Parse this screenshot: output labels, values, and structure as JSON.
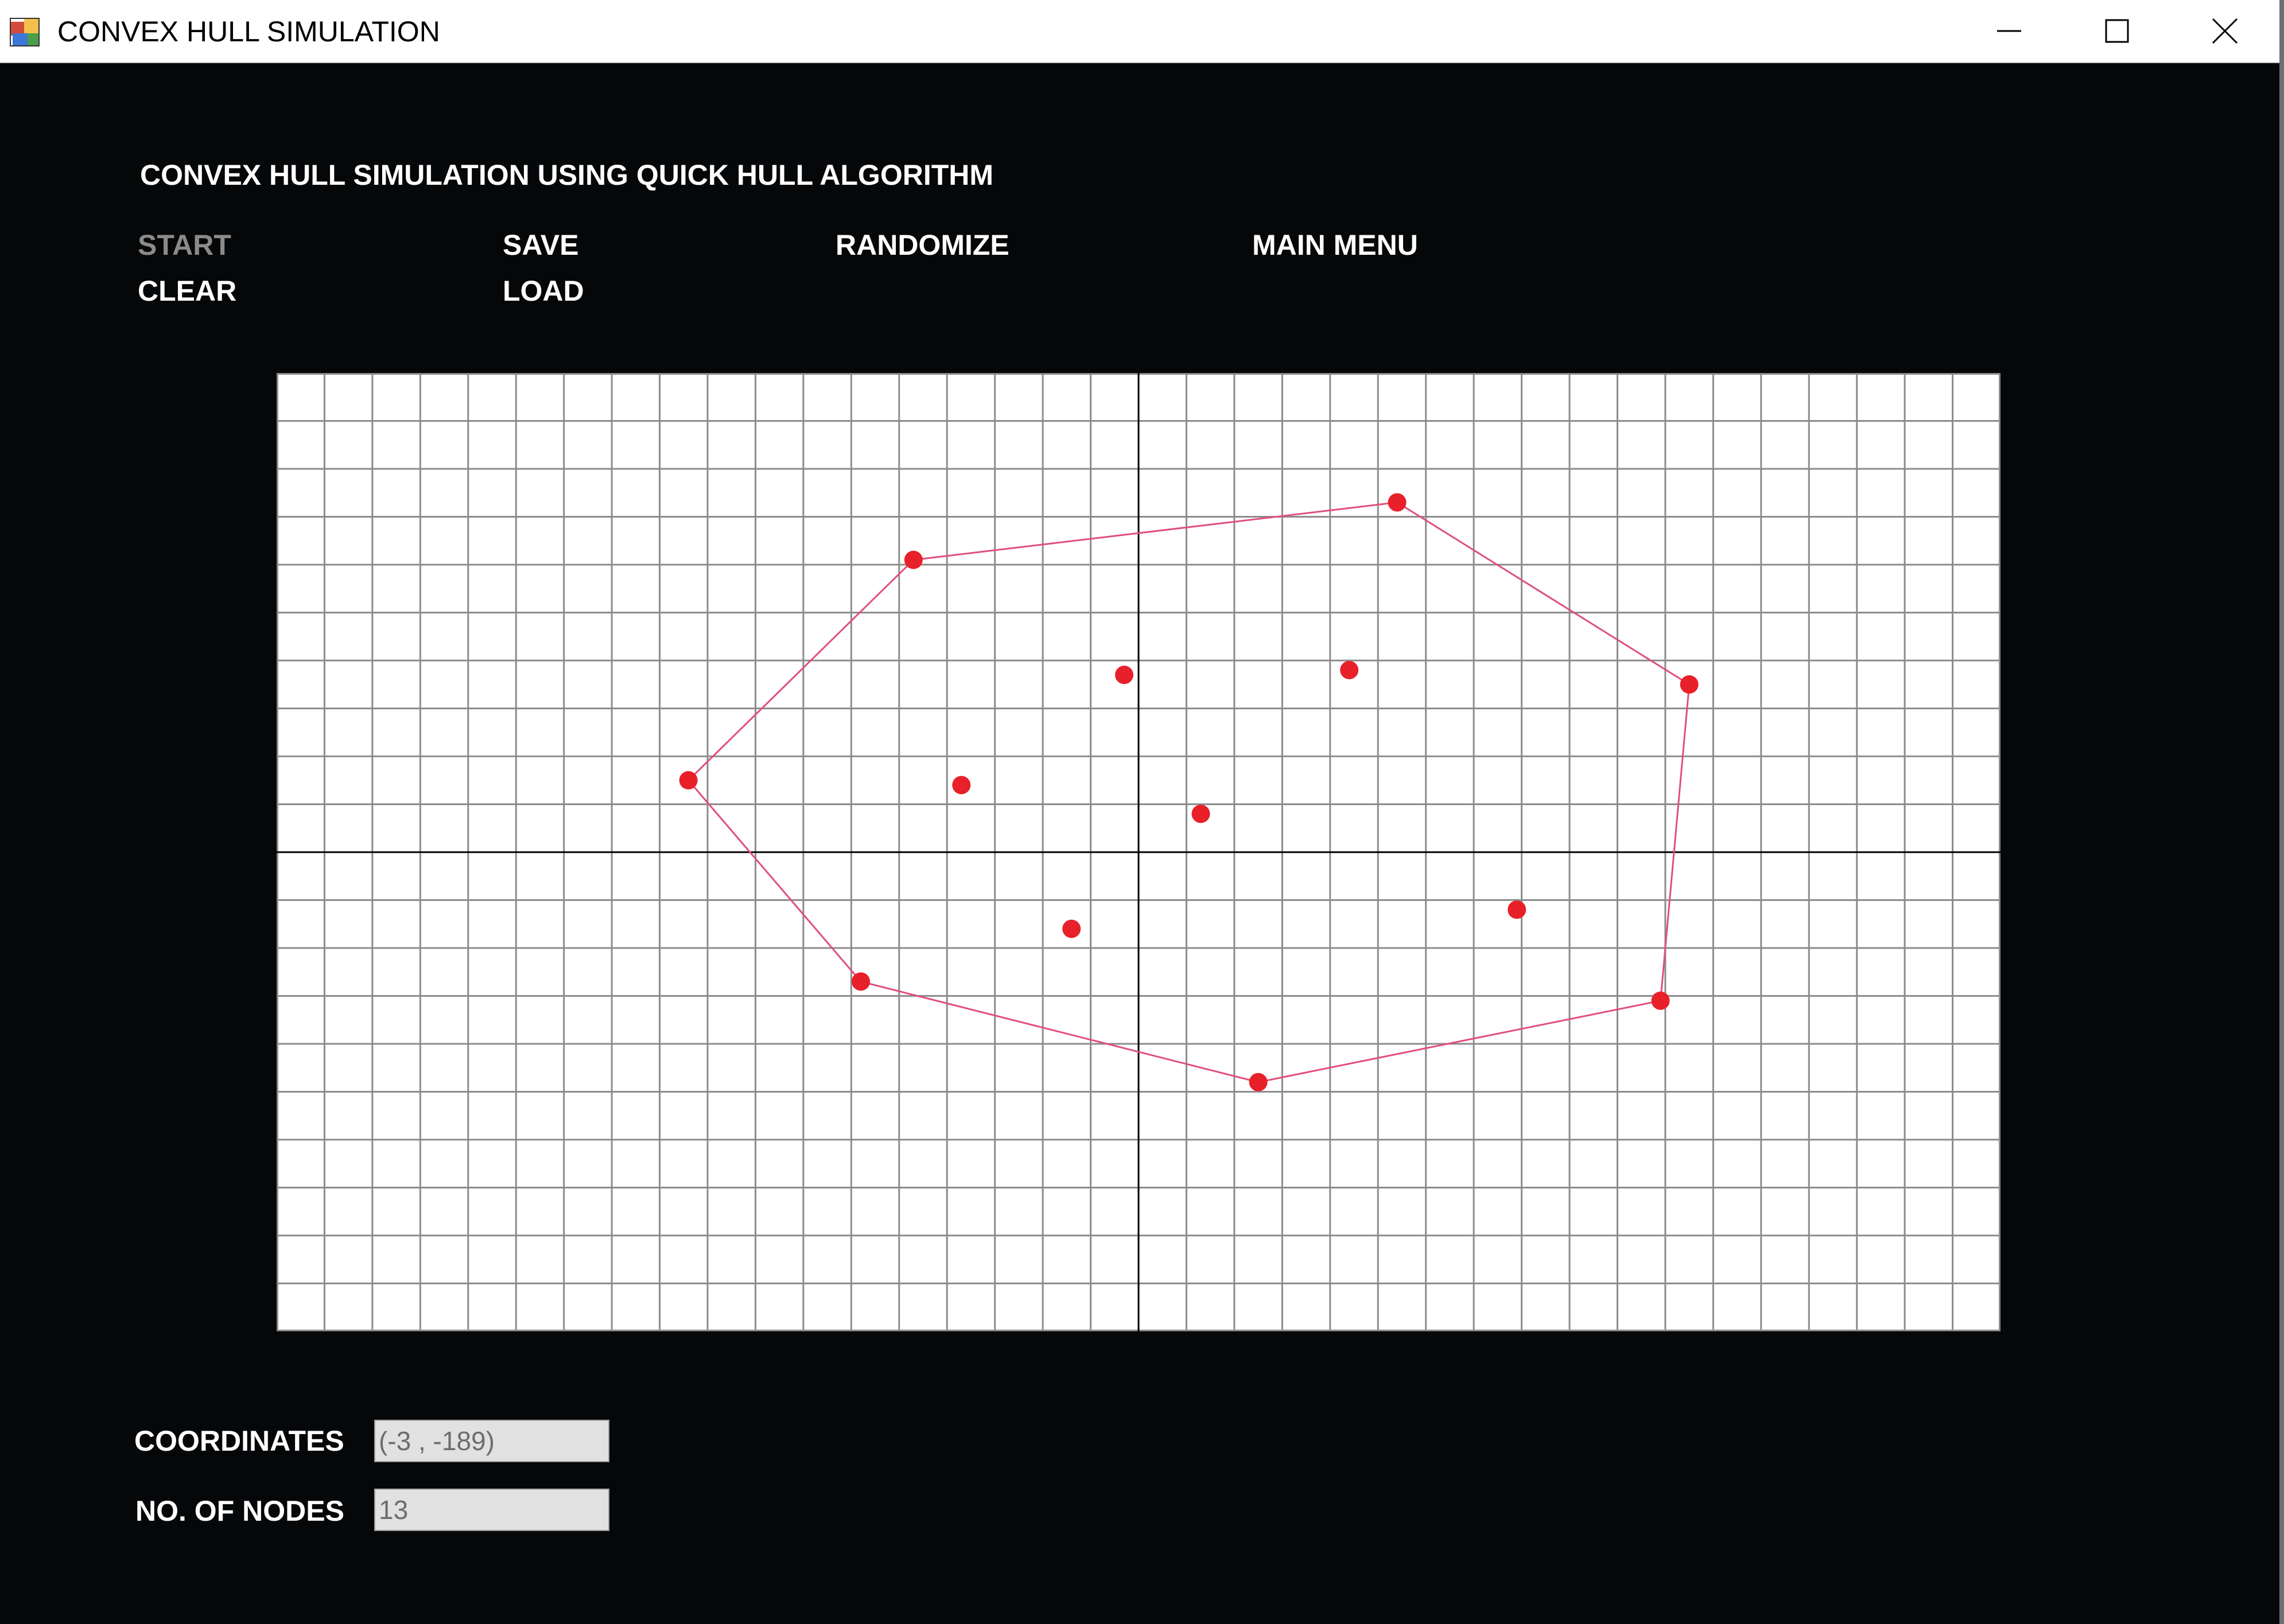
{
  "window": {
    "title": "CONVEX HULL SIMULATION",
    "icons": {
      "app": "app-icon",
      "minimize": "minimize-icon",
      "maximize": "maximize-icon",
      "close": "close-icon"
    }
  },
  "header": {
    "heading": "CONVEX HULL SIMULATION USING QUICK HULL ALGORITHM"
  },
  "menu": {
    "start": "START",
    "save": "SAVE",
    "randomize": "RANDOMIZE",
    "main_menu": "MAIN MENU",
    "clear": "CLEAR",
    "load": "LOAD"
  },
  "colors": {
    "background": "#050709",
    "grid_line": "#8c8c8c",
    "axis": "#000000",
    "node": "#e8202a",
    "hull": "#e0507a",
    "disabled_text": "#8a8a8a"
  },
  "chart_data": {
    "type": "scatter",
    "grid": true,
    "xlim": [
      -18,
      18
    ],
    "ylim": [
      -10,
      10
    ],
    "grid_step": 1,
    "points": [
      {
        "x": -4.7,
        "y": 6.1
      },
      {
        "x": 5.4,
        "y": 7.3
      },
      {
        "x": 11.5,
        "y": 3.5
      },
      {
        "x": 10.9,
        "y": -3.1
      },
      {
        "x": 2.5,
        "y": -4.8
      },
      {
        "x": -5.8,
        "y": -2.7
      },
      {
        "x": -9.4,
        "y": 1.5
      },
      {
        "x": -0.3,
        "y": 3.7
      },
      {
        "x": 4.4,
        "y": 3.8
      },
      {
        "x": -3.7,
        "y": 1.4
      },
      {
        "x": 1.3,
        "y": 0.8
      },
      {
        "x": -1.4,
        "y": -1.6
      },
      {
        "x": 7.9,
        "y": -1.2
      }
    ],
    "hull": [
      0,
      1,
      2,
      3,
      4,
      5,
      6
    ]
  },
  "status": {
    "coordinates_label": "COORDINATES",
    "coordinates_value": "(-3 , -189)",
    "nodes_label": "NO. OF NODES",
    "nodes_value": "13"
  }
}
